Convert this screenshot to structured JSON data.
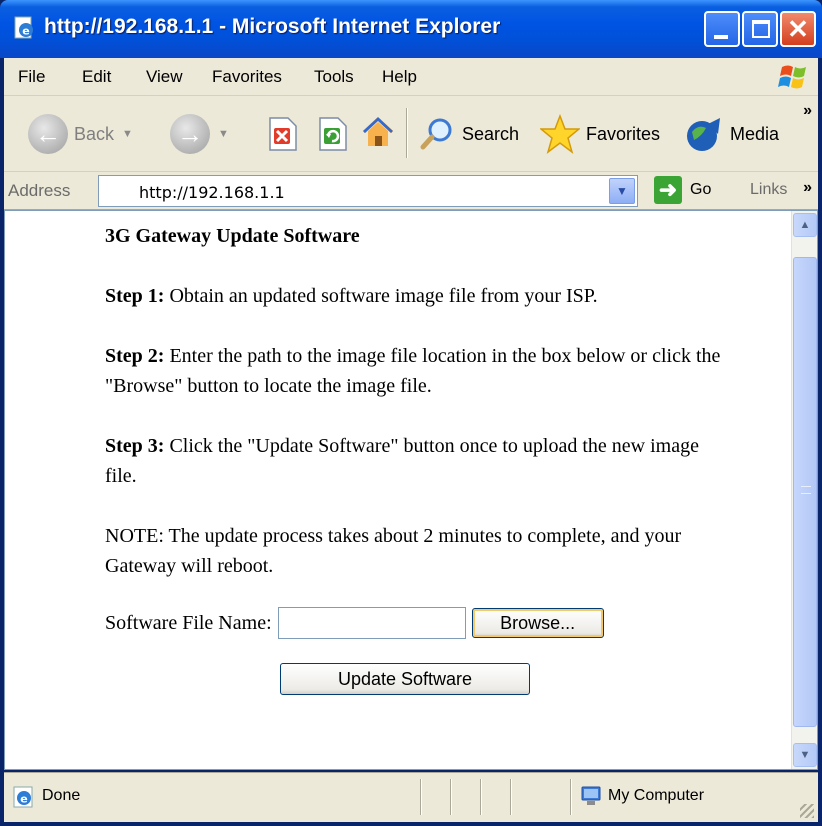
{
  "window": {
    "title": "http://192.168.1.1 - Microsoft Internet Explorer"
  },
  "menu": [
    "File",
    "Edit",
    "View",
    "Favorites",
    "Tools",
    "Help"
  ],
  "toolbar": {
    "back_label": "Back",
    "search_label": "Search",
    "favorites_label": "Favorites",
    "media_label": "Media"
  },
  "address": {
    "label": "Address",
    "url": "http://192.168.1.1",
    "go_label": "Go",
    "links_label": "Links"
  },
  "page": {
    "title": "3G Gateway Update Software",
    "step1_label": "Step 1:",
    "step1_text": " Obtain an updated software image file from your ISP.",
    "step2_label": "Step 2:",
    "step2_text": " Enter the path to the image file location in the box below or click the \"Browse\" button to locate the image file.",
    "step3_label": "Step 3:",
    "step3_text": " Click the \"Update Software\" button once to upload the new image file.",
    "note": "NOTE: The update process takes about 2 minutes to complete, and your Gateway will reboot.",
    "file_label": "Software File Name:",
    "file_value": "",
    "browse_label": "Browse...",
    "update_label": "Update Software"
  },
  "status": {
    "text": "Done",
    "zone": "My Computer"
  },
  "colors": {
    "titlebar": "#0054e3",
    "chrome": "#ece9d8",
    "close": "#d33f1e"
  }
}
